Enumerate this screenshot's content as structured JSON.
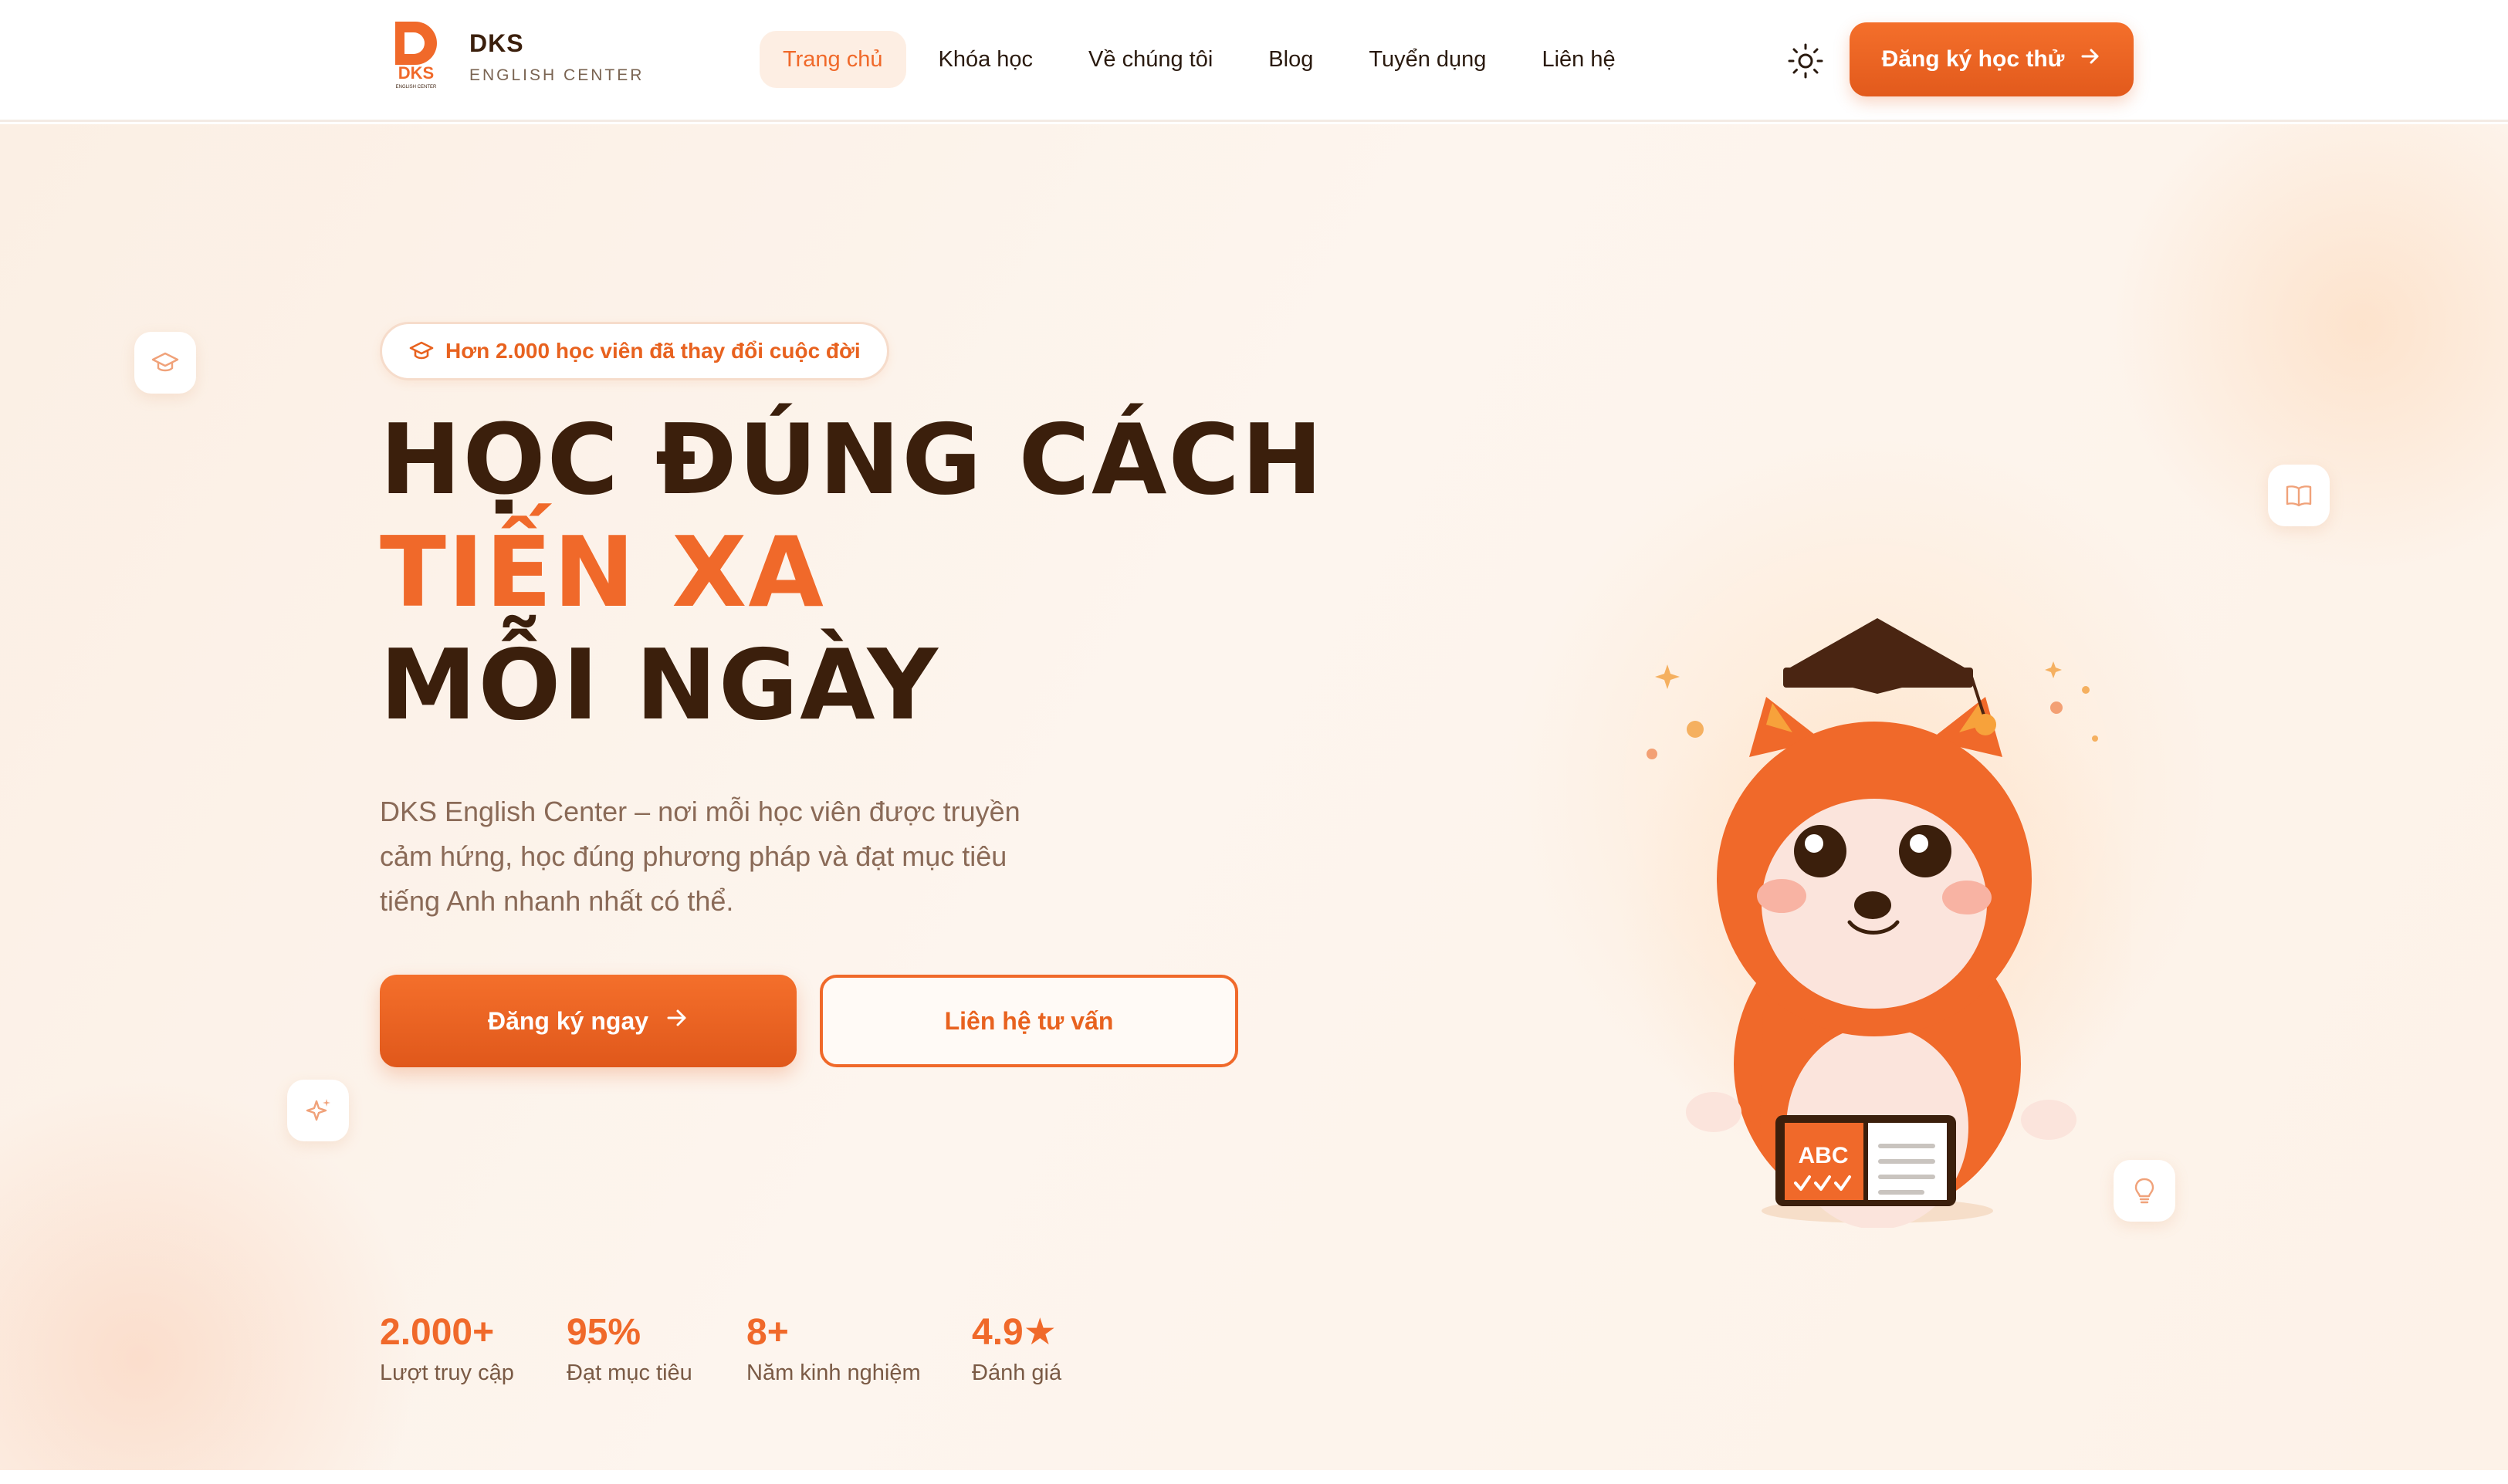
{
  "brand": {
    "logo_text": "DKS",
    "logo_subtext": "ENGLISH CENTER",
    "name": "DKS",
    "subtitle": "ENGLISH CENTER"
  },
  "nav": {
    "items": [
      {
        "label": "Trang chủ",
        "active": true
      },
      {
        "label": "Khóa học",
        "active": false
      },
      {
        "label": "Về chúng tôi",
        "active": false
      },
      {
        "label": "Blog",
        "active": false
      },
      {
        "label": "Tuyển dụng",
        "active": false
      },
      {
        "label": "Liên hệ",
        "active": false
      }
    ],
    "theme_toggle_icon": "sun-icon",
    "cta_label": "Đăng ký học thử",
    "cta_icon": "arrow-right-icon"
  },
  "hero": {
    "badge_icon": "graduation-cap-icon",
    "badge_text": "Hơn 2.000 học viên đã thay đổi cuộc đời",
    "headline_line1": "HỌC ĐÚNG CÁCH",
    "headline_line2": "TIẾN XA",
    "headline_line3": "MỖI NGÀY",
    "description": "DKS English Center – nơi mỗi học viên được truyền cảm hứng, học đúng phương pháp và đạt mục tiêu tiếng Anh nhanh nhất có thể.",
    "primary_button": "Đăng ký ngay",
    "secondary_button": "Liên hệ tư vấn",
    "stats": [
      {
        "value": "2.000+",
        "label": "Lượt truy cập"
      },
      {
        "value": "95%",
        "label": "Đạt mục tiêu"
      },
      {
        "value": "8+",
        "label": "Năm kinh nghiệm"
      },
      {
        "value": "4.9★",
        "label": "Đánh giá"
      }
    ],
    "mascot_book_text": "ABC",
    "floating_icons": [
      "graduation-cap-icon",
      "sparkles-icon",
      "book-open-icon",
      "lightbulb-icon"
    ]
  },
  "colors": {
    "accent": "#f0692a",
    "accent_dark": "#e25a1c",
    "heading": "#3b1f0c",
    "body_text": "#8a6a57",
    "hero_bg": "#fdf3ea"
  }
}
